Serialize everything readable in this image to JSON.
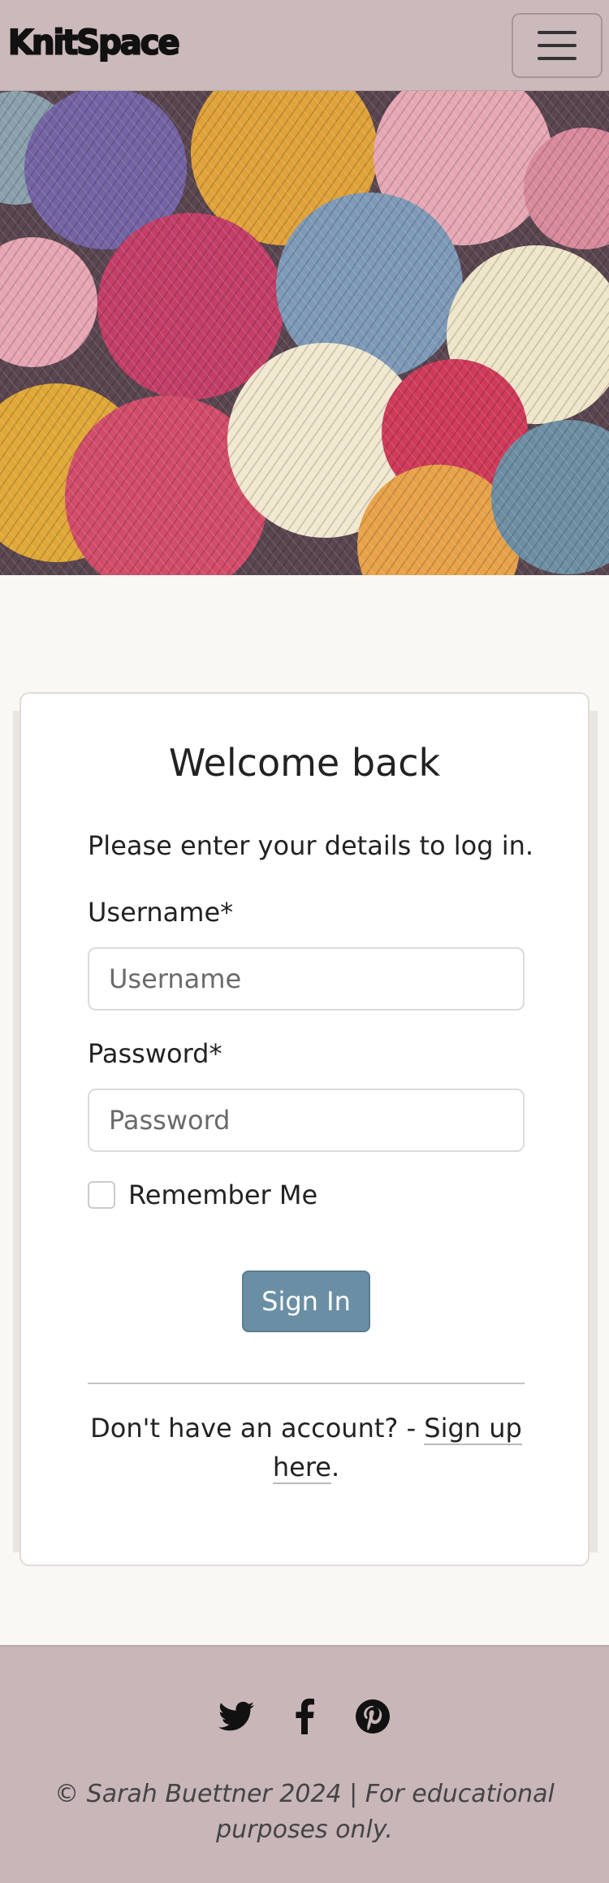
{
  "navbar": {
    "brand": "KnitSpace",
    "toggler_icon": "hamburger-menu-icon"
  },
  "hero": {
    "image": "colorful-yarn-balls",
    "colors": [
      "#7a6fa8",
      "#e0a33b",
      "#e8a9b4",
      "#c9406a",
      "#7e9ab8",
      "#efe6c9",
      "#d46a4a"
    ]
  },
  "login": {
    "title": "Welcome back",
    "intro": "Please enter your details to log in.",
    "username_label": "Username*",
    "username_placeholder": "Username",
    "username_value": "",
    "password_label": "Password*",
    "password_placeholder": "Password",
    "password_value": "",
    "remember_label": "Remember Me",
    "remember_checked": false,
    "signin_label": "Sign In",
    "signup_prefix": "Don't have an account? - ",
    "signup_link": "Sign up here",
    "signup_suffix": "."
  },
  "footer": {
    "socials": [
      "twitter-icon",
      "facebook-icon",
      "pinterest-icon"
    ],
    "copyright": "© Sarah Buettner 2024 | For educational purposes only."
  },
  "colors": {
    "nav_bg": "#cbb9bc",
    "page_bg": "#f9f8f5",
    "button_bg": "#6a8fa4",
    "footer_bg": "#c8b6b9"
  }
}
